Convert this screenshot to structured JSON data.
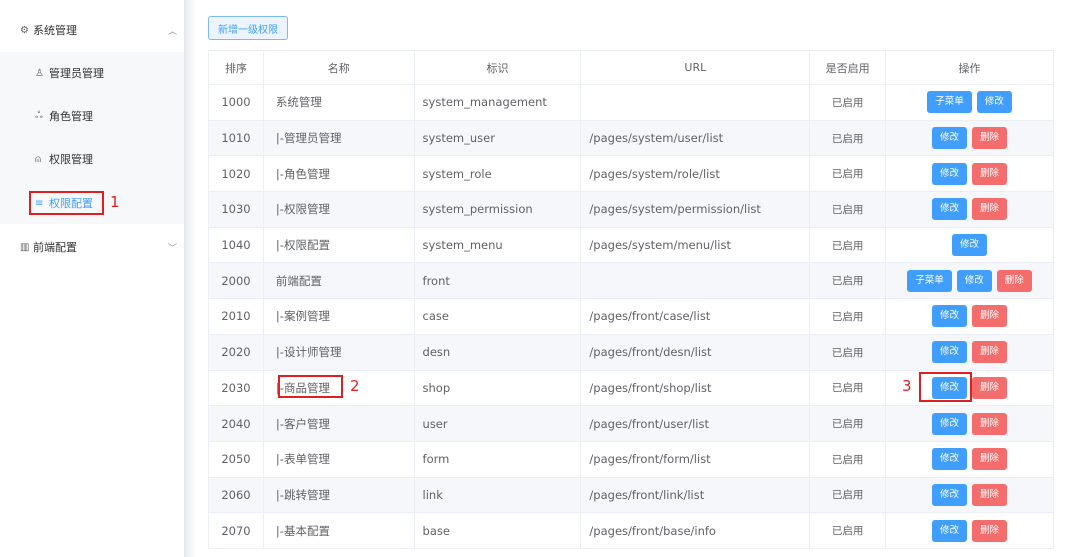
{
  "sidebar": {
    "groups": [
      {
        "label": "系统管理",
        "icon": "gear-icon",
        "chevron": "chevron-up-icon"
      },
      {
        "label": "前端配置",
        "icon": "map-icon",
        "chevron": "chevron-down-icon"
      }
    ],
    "items": [
      {
        "label": "管理员管理",
        "icon": "user-icon"
      },
      {
        "label": "角色管理",
        "icon": "role-icon"
      },
      {
        "label": "权限管理",
        "icon": "lock-icon"
      },
      {
        "label": "权限配置",
        "icon": "menu-lines-icon",
        "active": true
      }
    ]
  },
  "toolbar": {
    "add_label": "新增一级权限"
  },
  "table": {
    "headers": [
      "排序",
      "名称",
      "标识",
      "URL",
      "是否启用",
      "操作"
    ],
    "op_labels": {
      "submenu": "子菜单",
      "edit": "修改",
      "delete": "删除"
    },
    "rows": [
      {
        "order": "1000",
        "name": "系统管理",
        "flag": "system_management",
        "url": "",
        "status": "已启用",
        "ops": [
          "submenu",
          "edit"
        ]
      },
      {
        "order": "1010",
        "name": "|-管理员管理",
        "flag": "system_user",
        "url": "/pages/system/user/list",
        "status": "已启用",
        "ops": [
          "edit",
          "delete"
        ]
      },
      {
        "order": "1020",
        "name": "|-角色管理",
        "flag": "system_role",
        "url": "/pages/system/role/list",
        "status": "已启用",
        "ops": [
          "edit",
          "delete"
        ]
      },
      {
        "order": "1030",
        "name": "|-权限管理",
        "flag": "system_permission",
        "url": "/pages/system/permission/list",
        "status": "已启用",
        "ops": [
          "edit",
          "delete"
        ]
      },
      {
        "order": "1040",
        "name": "|-权限配置",
        "flag": "system_menu",
        "url": "/pages/system/menu/list",
        "status": "已启用",
        "ops": [
          "edit"
        ]
      },
      {
        "order": "2000",
        "name": "前端配置",
        "flag": "front",
        "url": "",
        "status": "已启用",
        "ops": [
          "submenu",
          "edit",
          "delete"
        ]
      },
      {
        "order": "2010",
        "name": "|-案例管理",
        "flag": "case",
        "url": "/pages/front/case/list",
        "status": "已启用",
        "ops": [
          "edit",
          "delete"
        ]
      },
      {
        "order": "2020",
        "name": "|-设计师管理",
        "flag": "desn",
        "url": "/pages/front/desn/list",
        "status": "已启用",
        "ops": [
          "edit",
          "delete"
        ]
      },
      {
        "order": "2030",
        "name": "|-商品管理",
        "flag": "shop",
        "url": "/pages/front/shop/list",
        "status": "已启用",
        "ops": [
          "edit",
          "delete"
        ]
      },
      {
        "order": "2040",
        "name": "|-客户管理",
        "flag": "user",
        "url": "/pages/front/user/list",
        "status": "已启用",
        "ops": [
          "edit",
          "delete"
        ]
      },
      {
        "order": "2050",
        "name": "|-表单管理",
        "flag": "form",
        "url": "/pages/front/form/list",
        "status": "已启用",
        "ops": [
          "edit",
          "delete"
        ]
      },
      {
        "order": "2060",
        "name": "|-跳转管理",
        "flag": "link",
        "url": "/pages/front/link/list",
        "status": "已启用",
        "ops": [
          "edit",
          "delete"
        ]
      },
      {
        "order": "2070",
        "name": "|-基本配置",
        "flag": "base",
        "url": "/pages/front/base/info",
        "status": "已启用",
        "ops": [
          "edit",
          "delete"
        ]
      }
    ]
  },
  "annotations": {
    "n1": "1",
    "n2": "2",
    "n3": "3"
  },
  "colors": {
    "primary": "#409eff",
    "danger": "#f56c6c",
    "annotation": "#e02020",
    "stripe": "#f5f7fa"
  }
}
